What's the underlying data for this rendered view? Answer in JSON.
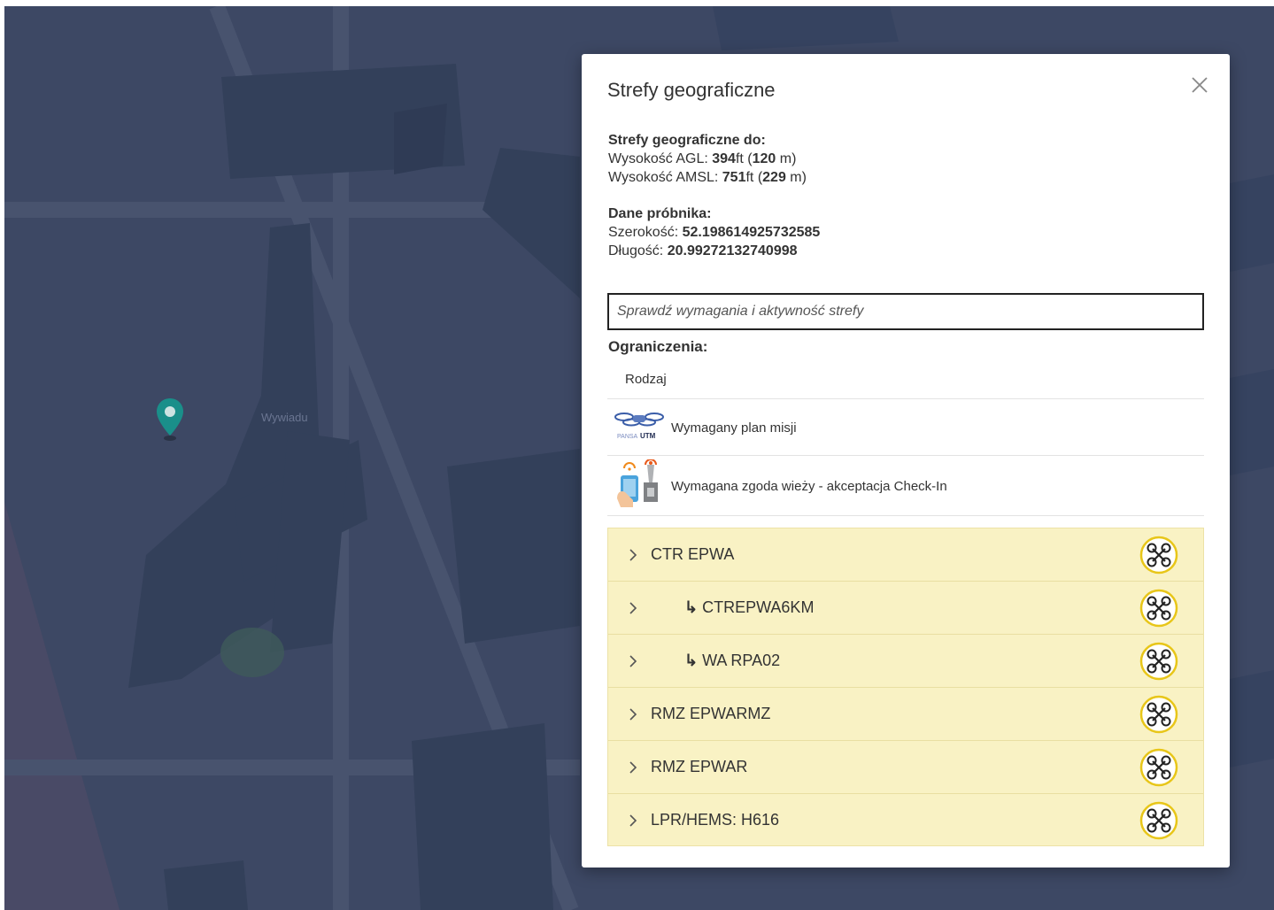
{
  "map": {
    "place_label": "Wywiadu"
  },
  "dialog": {
    "title": "Strefy geograficzne",
    "close_label": "×",
    "zones_up_to": {
      "heading": "Strefy geograficzne do:",
      "agl_label": "Wysokość AGL: ",
      "agl_ft": "394",
      "agl_m": "120",
      "amsl_label": "Wysokość AMSL: ",
      "amsl_ft": "751",
      "amsl_m": "229",
      "ft_unit": "ft (",
      "m_unit": " m)"
    },
    "probe": {
      "heading": "Dane próbnika:",
      "lat_label": "Szerokość: ",
      "lat_value": "52.198614925732585",
      "lon_label": "Długość: ",
      "lon_value": "20.99272132740998"
    },
    "check_input": {
      "placeholder": "Sprawdź wymagania i aktywność strefy"
    },
    "restrictions": {
      "title": "Ograniczenia:",
      "column_header": "Rodzaj",
      "items": [
        {
          "label": "Wymagany plan misji",
          "icon": "pansa-utm-logo-icon"
        },
        {
          "label": "Wymagana zgoda wieży - akceptacja Check-In",
          "icon": "tower-checkin-icon"
        }
      ]
    },
    "zones": [
      {
        "name": "CTR EPWA",
        "sub": false
      },
      {
        "name": "CTREPWA6KM",
        "sub": true
      },
      {
        "name": "WA RPA02",
        "sub": true
      },
      {
        "name": "RMZ EPWARMZ",
        "sub": false
      },
      {
        "name": "RMZ EPWAR",
        "sub": false
      },
      {
        "name": "LPR/HEMS: H616",
        "sub": false
      }
    ],
    "zone_sub_prefix": "↳ ",
    "colors": {
      "zone_bg": "#f9f2c4",
      "drone_ring": "#e8c619",
      "map_bg": "#3d4864"
    }
  }
}
